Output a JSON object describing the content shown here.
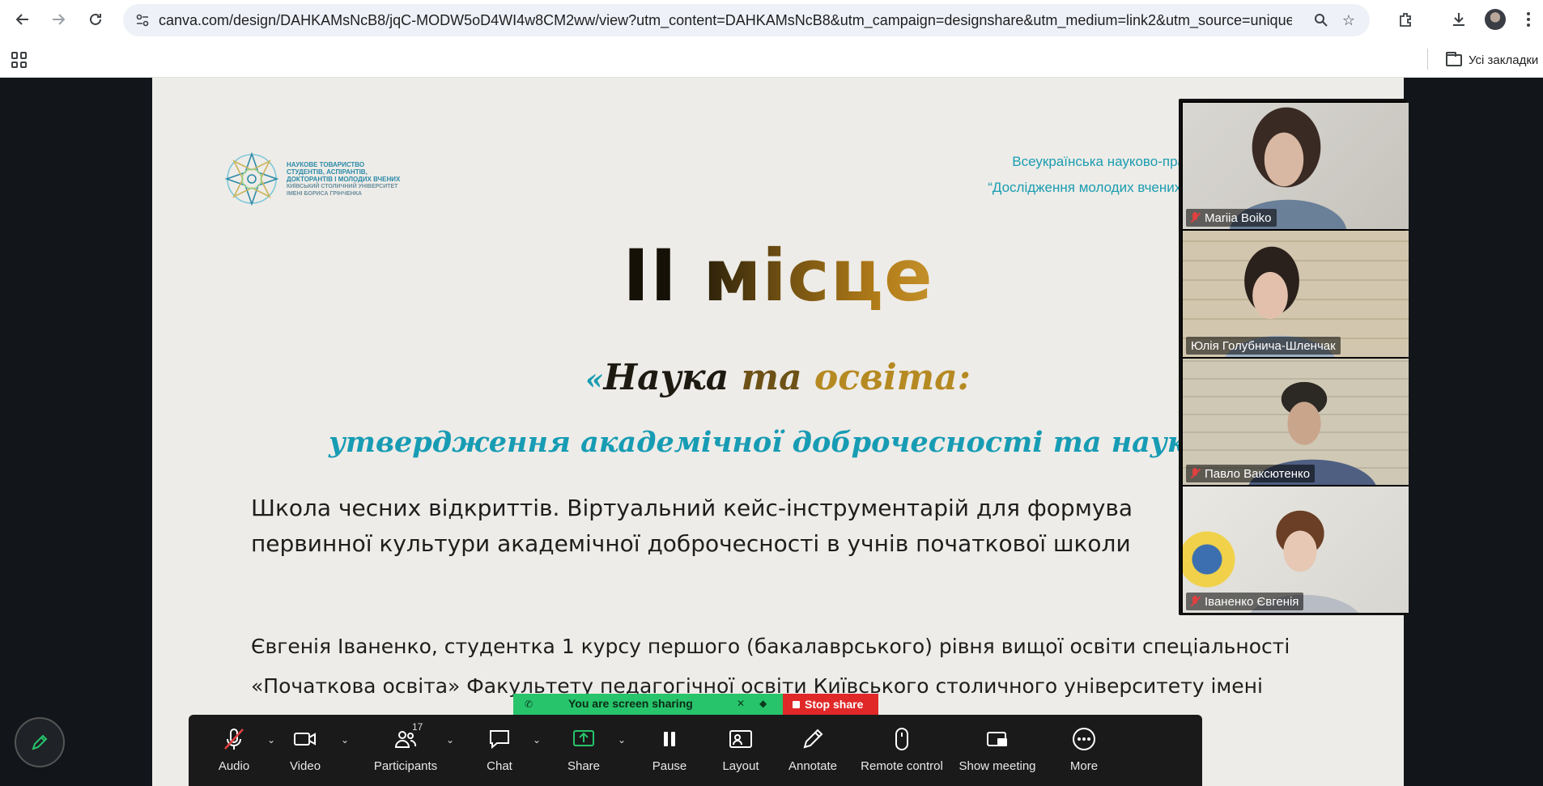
{
  "browser": {
    "url": "canva.com/design/DAHKAMsNcB8/jqC-MODW5oD4WI4w8CM2ww/view?utm_content=DAHKAMsNcB8&utm_campaign=designshare&utm_medium=link2&utm_source=uniquelink...",
    "bookmarks_label": "Усі закладки"
  },
  "slide": {
    "logo_lines": [
      "НАУКОВЕ ТОВАРИСТВО",
      "СТУДЕНТІВ, АСПІРАНТІВ,",
      "ДОКТОРАНТІВ І МОЛОДИХ ВЧЕНИХ"
    ],
    "logo_sub": [
      "КИЇВСЬКИЙ СТОЛИЧНИЙ УНІВЕРСИТЕТ",
      "ІМЕНІ БОРИСА ГРІНЧЕНКА"
    ],
    "conference_line1": "Всеукраїнська науково-пра",
    "conference_line2": "“Дослідження молодих вчених:",
    "place": "II місце",
    "title_quote": "«",
    "title_word1": "Наука ",
    "title_word2": "та ",
    "title_word3": "освіта:",
    "subtitle": "утвердження академічної доброчесності та наукової етик",
    "work_line1": "Школа чесних відкриттів.  Віртуальний кейс-інструментарій для формува",
    "work_line2": "первинної культури академічної доброчесності  в учнів початкової школи",
    "author_line1": "Євгенія Іваненко, студентка 1 курсу першого (бакалаврського) рівня  вищої освіти спеціальності",
    "author_line2": "«Початкова освіта» Факультету педагогічної освіти Київського столичного університету імені"
  },
  "participants": [
    {
      "name": "Mariia Boiko",
      "muted": true,
      "active": false
    },
    {
      "name": "Юлія Голубнича-Шленчак",
      "muted": false,
      "active": true
    },
    {
      "name": "Павло Ваксютенко",
      "muted": true,
      "active": false
    },
    {
      "name": "Іваненко Євгенія",
      "muted": true,
      "active": false
    }
  ],
  "share_bar": {
    "status": "You are screen sharing",
    "stop": "Stop share"
  },
  "toolbar": {
    "audio": "Audio",
    "video": "Video",
    "participants": "Participants",
    "participants_count": "17",
    "chat": "Chat",
    "share": "Share",
    "pause": "Pause",
    "layout": "Layout",
    "annotate": "Annotate",
    "remote_control": "Remote control",
    "show_meeting": "Show meeting",
    "more": "More"
  },
  "colors": {
    "share_green": "#27c46b",
    "stop_red": "#e02828",
    "active_speaker": "#22d67a",
    "slide_bg": "#eeece8",
    "teal": "#179cb4"
  }
}
